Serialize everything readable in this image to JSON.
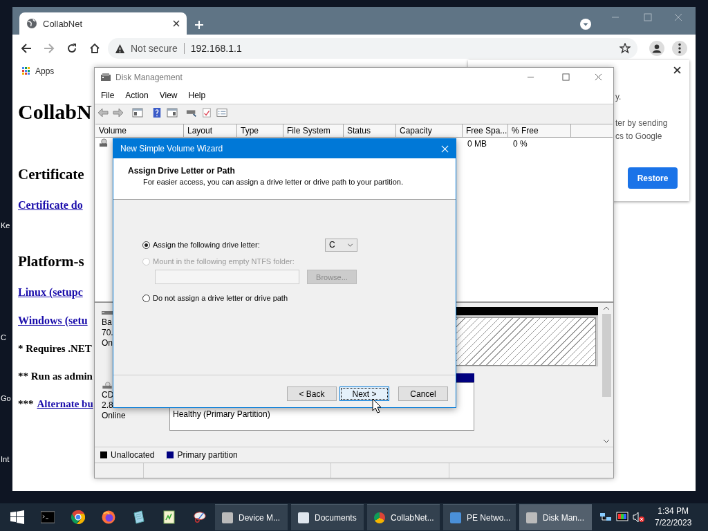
{
  "desktop": {
    "icon_labels": [
      "Ke",
      "C",
      "Go",
      "Int"
    ]
  },
  "browser": {
    "tab": {
      "title": "CollabNet"
    },
    "address": {
      "security": "Not secure",
      "url": "192.168.1.1"
    },
    "bookmarks": [
      "Apps"
    ],
    "page": [
      {
        "kind": "h1",
        "text": "CollabN"
      },
      {
        "kind": "h2",
        "text": "Certificate"
      },
      {
        "kind": "link",
        "text": "Certificate do"
      },
      {
        "kind": "h2",
        "text": "Platform-s"
      },
      {
        "kind": "link",
        "text": "Linux (setupc"
      },
      {
        "kind": "link",
        "text": "Windows (setu"
      },
      {
        "kind": "note",
        "text": "* Requires .NET"
      },
      {
        "kind": "note",
        "text": "** Run as admin"
      },
      {
        "kind": "note",
        "text": "***",
        "link": "Alternate bu"
      }
    ],
    "popup": {
      "lines": [
        "y.",
        "ter by sending",
        "cs to Google"
      ],
      "button": "Restore"
    }
  },
  "disk_management": {
    "title": "Disk Management",
    "menu": [
      "File",
      "Action",
      "View",
      "Help"
    ],
    "columns": [
      "Volume",
      "Layout",
      "Type",
      "File System",
      "Status",
      "Capacity",
      "Free Spa...",
      "% Free"
    ],
    "row": {
      "free_space": "0 MB",
      "percent_free": "0 %"
    },
    "disks": [
      {
        "kind": "unallocated",
        "lines": [
          "Ba",
          "70.",
          "On"
        ]
      },
      {
        "kind": "primary",
        "lines": [
          "CD",
          "2.8",
          "Online"
        ],
        "partition_status": "Healthy (Primary Partition)"
      }
    ],
    "legend": [
      {
        "label": "Unallocated",
        "color": "#000000"
      },
      {
        "label": "Primary partition",
        "color": "#000080"
      }
    ]
  },
  "wizard": {
    "title": "New Simple Volume Wizard",
    "heading": "Assign Drive Letter or Path",
    "description": "For easier access, you can assign a drive letter or drive path to your partition.",
    "options": [
      {
        "label": "Assign the following drive letter:",
        "selected": true,
        "disabled": false
      },
      {
        "label": "Mount in the following empty NTFS folder:",
        "selected": false,
        "disabled": true
      },
      {
        "label": "Do not assign a drive letter or drive path",
        "selected": false,
        "disabled": false
      }
    ],
    "drive_letter": "C",
    "browse_button": "Browse...",
    "buttons": [
      {
        "label": "< Back",
        "focused": false
      },
      {
        "label": "Next >",
        "focused": true
      },
      {
        "label": "Cancel",
        "focused": false
      }
    ]
  },
  "taskbar": {
    "windows": [
      {
        "label": "Device M...",
        "active": false
      },
      {
        "label": "Documents",
        "active": false
      },
      {
        "label": "CollabNet...",
        "active": false
      },
      {
        "label": "PE Netwo...",
        "active": false
      },
      {
        "label": "Disk Man...",
        "active": true
      }
    ],
    "time": "1:34 PM",
    "date": "7/22/2023"
  }
}
